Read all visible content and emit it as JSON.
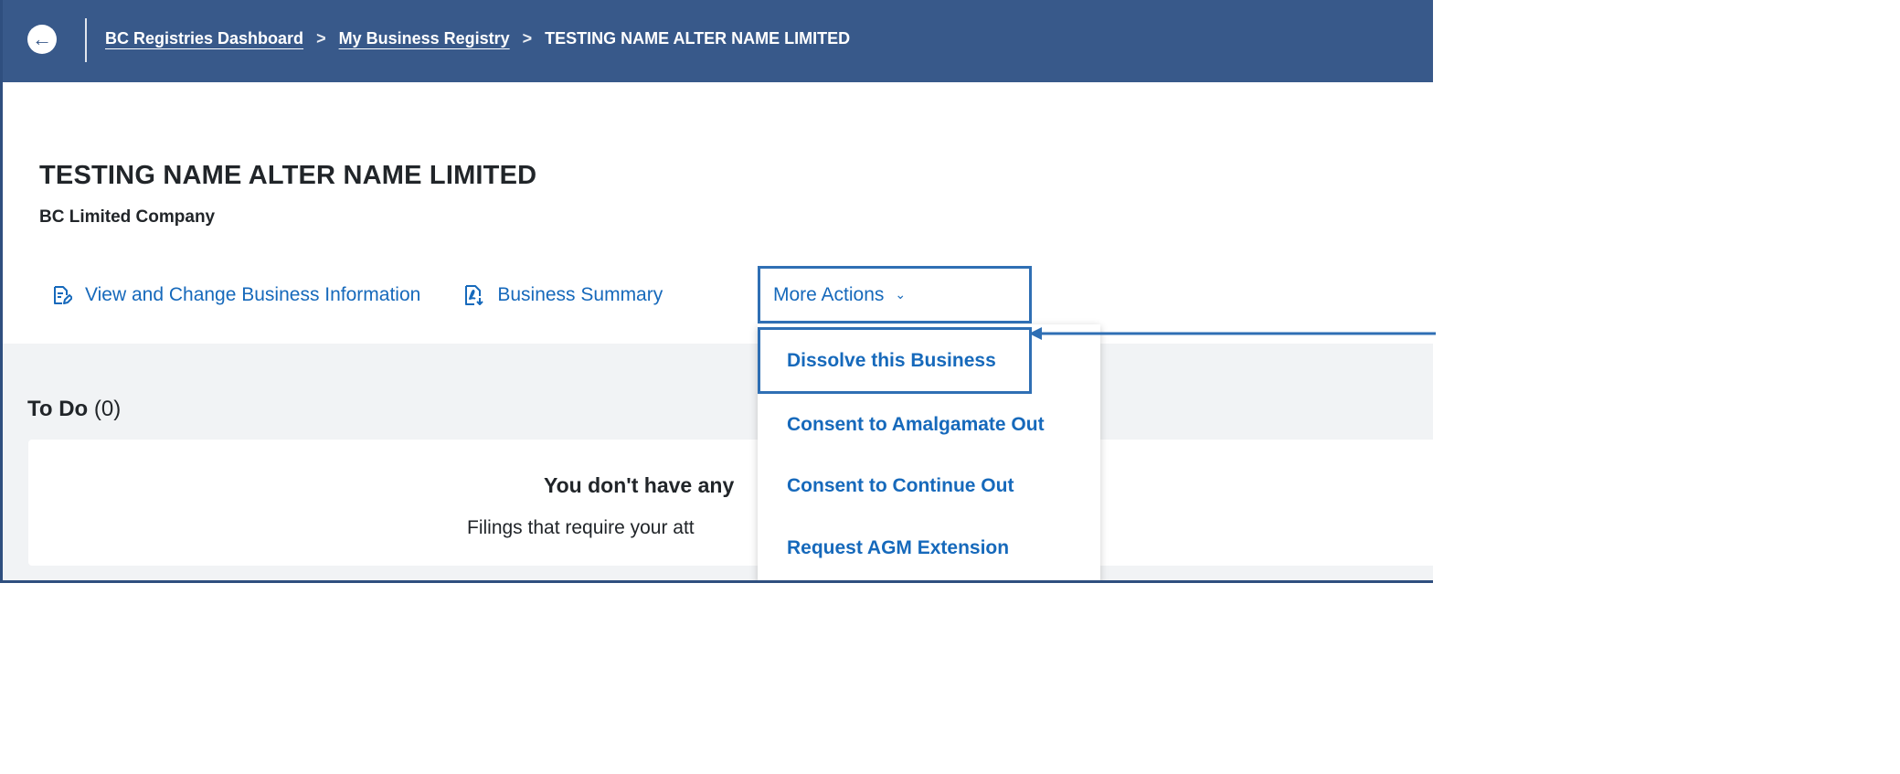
{
  "topbar": {
    "back_icon": "arrow-left-icon",
    "breadcrumb": [
      {
        "label": "BC Registries Dashboard",
        "link": true
      },
      {
        "label": "My Business Registry",
        "link": true
      },
      {
        "label": "TESTING NAME ALTER NAME LIMITED",
        "link": false
      }
    ],
    "separator": ">"
  },
  "entity": {
    "name": "TESTING NAME ALTER NAME LIMITED",
    "type": "BC Limited Company"
  },
  "actions": {
    "view_change": "View and Change Business Information",
    "view_change_icon": "edit-document-icon",
    "summary": "Business Summary",
    "summary_icon": "pdf-download-icon",
    "more_actions": "More Actions",
    "more_actions_icon": "chevron-down-icon"
  },
  "menu": {
    "items": [
      "Dissolve this Business",
      "Consent to Amalgamate Out",
      "Consent to Continue Out",
      "Request AGM Extension"
    ]
  },
  "todo": {
    "title": "To Do",
    "count": "(0)",
    "empty_title": "You don't have any",
    "empty_subtitle": "Filings that require your att"
  },
  "colors": {
    "header": "#38598a",
    "link": "#1669bb",
    "highlight_border": "#2f6fb4",
    "background_gray": "#f1f3f5"
  }
}
